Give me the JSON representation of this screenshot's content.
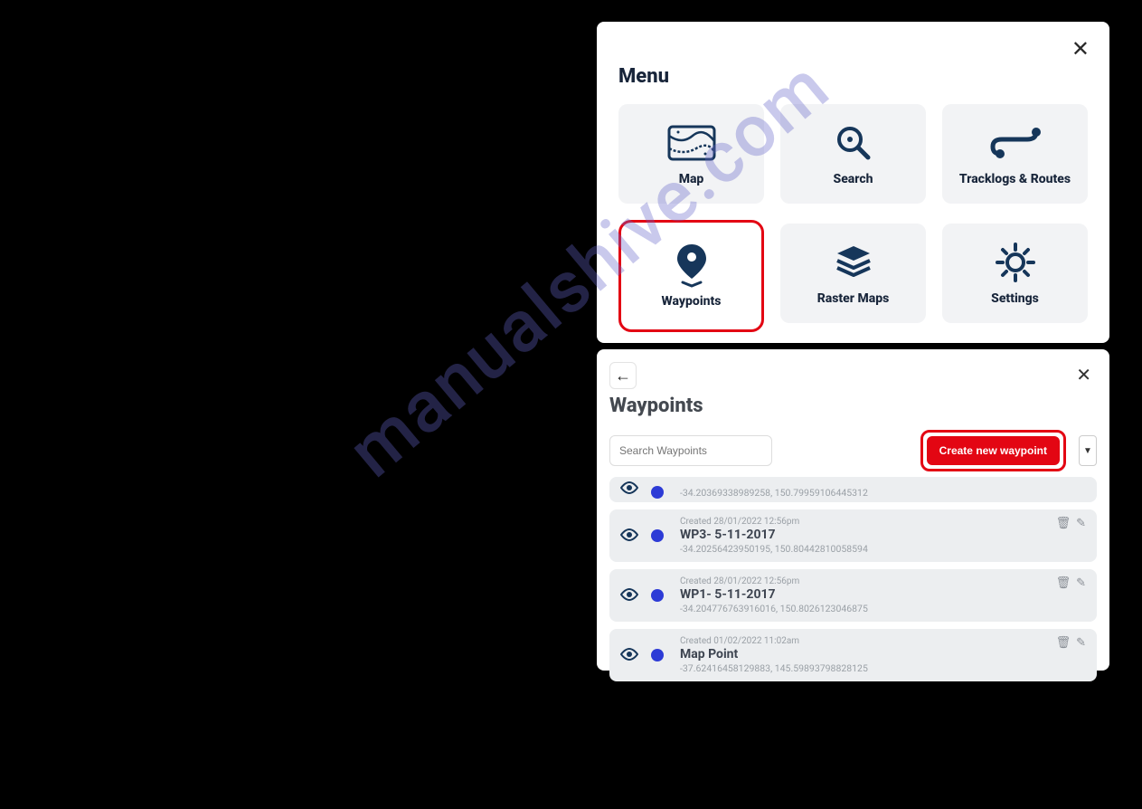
{
  "watermark": "manualshive.com",
  "menu": {
    "title": "Menu",
    "items": [
      {
        "label": "Map"
      },
      {
        "label": "Search"
      },
      {
        "label": "Tracklogs & Routes"
      },
      {
        "label": "Waypoints",
        "highlight": true
      },
      {
        "label": "Raster Maps"
      },
      {
        "label": "Settings"
      }
    ]
  },
  "waypoints": {
    "title": "Waypoints",
    "search_placeholder": "Search Waypoints",
    "create_label": "Create new waypoint",
    "items": [
      {
        "coords": "-34.20369338989258, 150.79959106445312"
      },
      {
        "created": "Created 28/01/2022 12:56pm",
        "name": "WP3- 5-11-2017",
        "coords": "-34.20256423950195, 150.80442810058594"
      },
      {
        "created": "Created 28/01/2022 12:56pm",
        "name": "WP1- 5-11-2017",
        "coords": "-34.204776763916016, 150.8026123046875"
      },
      {
        "created": "Created 01/02/2022 11:02am",
        "name": "Map Point",
        "coords": "-37.62416458129883, 145.59893798828125"
      }
    ]
  }
}
